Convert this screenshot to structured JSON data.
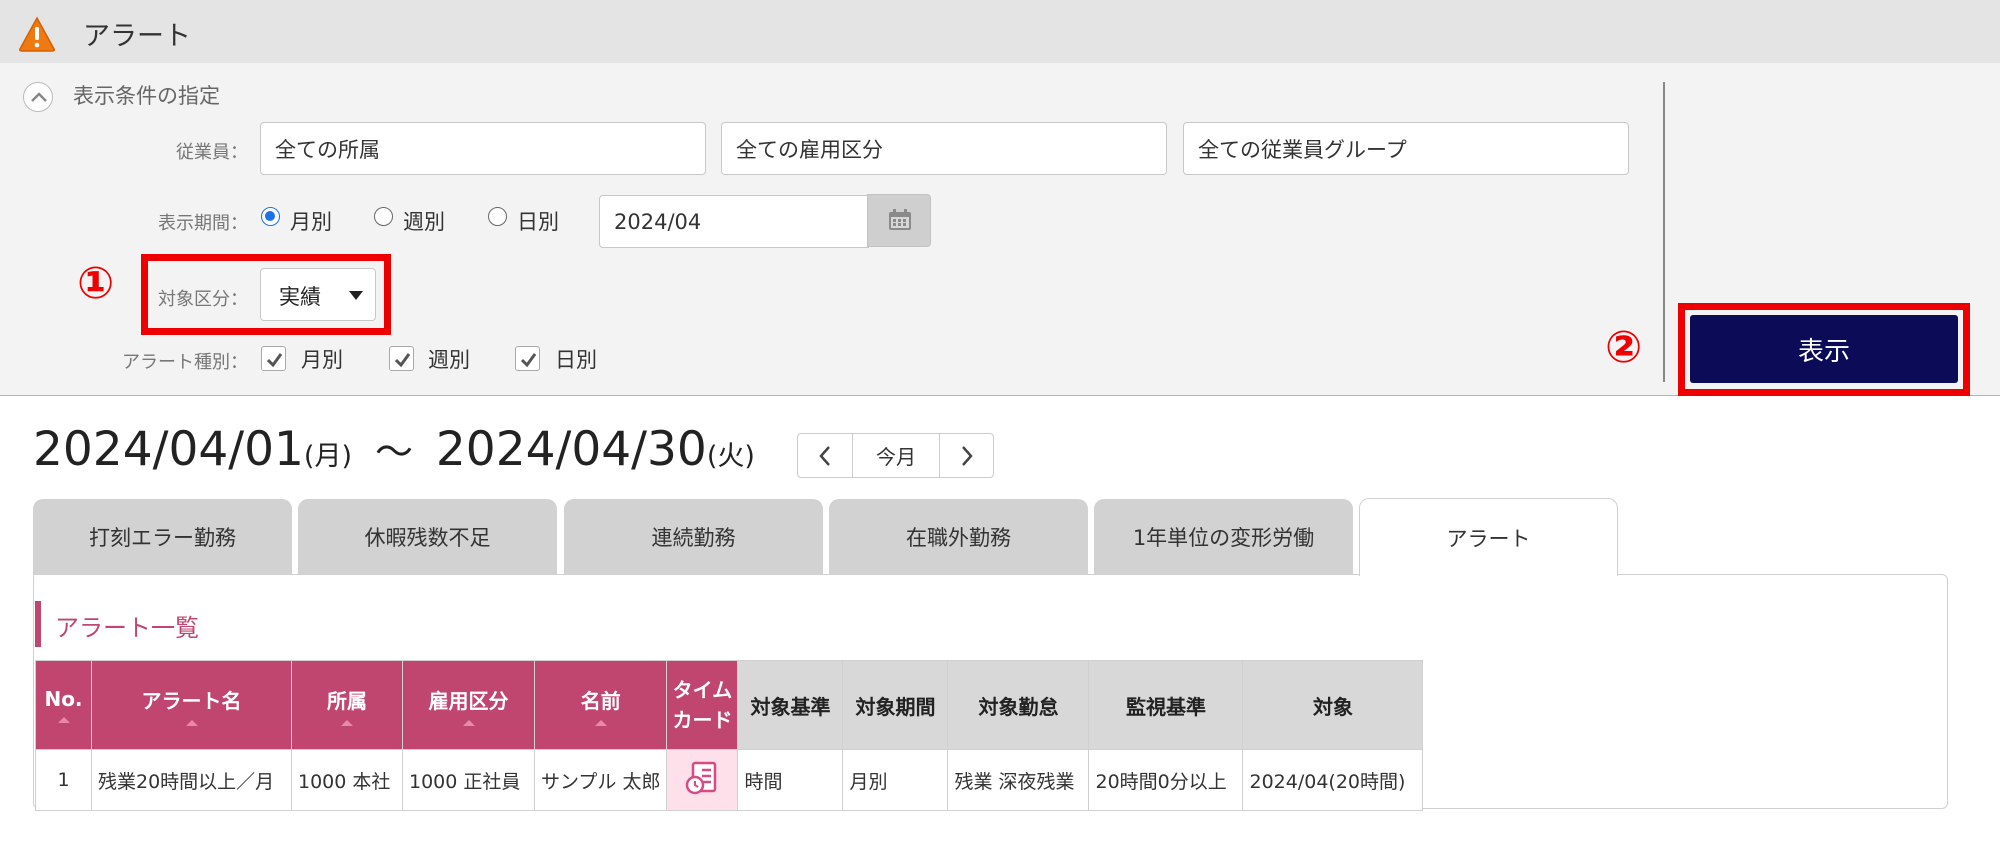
{
  "header": {
    "title": "アラート",
    "icon": "warning-icon"
  },
  "filter": {
    "section_title": "表示条件の指定",
    "employee_label": "従業員：",
    "employee_fields": [
      "全ての所属",
      "全ての雇用区分",
      "全ての従業員グループ"
    ],
    "period_label": "表示期間：",
    "period_options": [
      "月別",
      "週別",
      "日別"
    ],
    "period_selected": "月別",
    "period_value": "2024/04",
    "target_label": "対象区分：",
    "target_value": "実績",
    "alert_type_label": "アラート種別：",
    "alert_types": [
      "月別",
      "週別",
      "日別"
    ],
    "show_button": "表示",
    "callout_1": "①",
    "callout_2": "②"
  },
  "range": {
    "start": "2024/04/01",
    "start_dow": "(月)",
    "sep": "〜",
    "end": "2024/04/30",
    "end_dow": "(火)",
    "today_label": "今月"
  },
  "tabs": [
    "打刻エラー勤務",
    "休暇残数不足",
    "連続勤務",
    "在職外勤務",
    "1年単位の変形労働",
    "アラート"
  ],
  "active_tab": "アラート",
  "list": {
    "title": "アラート一覧",
    "columns": [
      "No.",
      "アラート名",
      "所属",
      "雇用区分",
      "名前",
      "タイムカード",
      "対象基準",
      "対象期間",
      "対象勤怠",
      "監視基準",
      "対象"
    ],
    "timecard_header": [
      "タイム",
      "カード"
    ],
    "rows": [
      {
        "no": "1",
        "alert_name": "残業20時間以上／月",
        "dept": "1000 本社",
        "emp_type": "1000 正社員",
        "name": "サンプル 太郎",
        "basis": "時間",
        "period": "月別",
        "attendance": "残業 深夜残業",
        "monitor": "20時間0分以上",
        "target": "2024/04(20時間)"
      }
    ]
  },
  "colors": {
    "accent": "#c0466f",
    "primary_button": "#0b0b57",
    "callout": "#ee0000",
    "radio": "#1a73e8"
  }
}
